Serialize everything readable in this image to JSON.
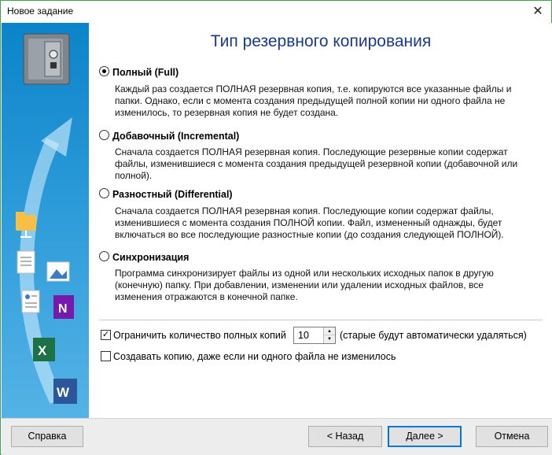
{
  "window": {
    "title": "Новое задание",
    "close": "✕"
  },
  "heading": "Тип резервного копирования",
  "options": [
    {
      "label": "Полный (Full)",
      "checked": true,
      "desc": [
        "Каждый раз создается ПОЛНАЯ резервная копия, т.е. копируются все указанные файлы и",
        "папки. Однако, если с момента создания предыдущей полной копии ни одного файла не",
        "изменилось, то резервная копия не будет создана."
      ]
    },
    {
      "label": "Добавочный (Incremental)",
      "checked": false,
      "desc": [
        "Сначала создается ПОЛНАЯ резервная копия. Последующие резервные копии содержат",
        "файлы, изменившиеся с момента создания предыдущей резервной копии (добавочной или",
        "полной)."
      ]
    },
    {
      "label": "Разностный (Differential)",
      "checked": false,
      "desc": [
        "Сначала создается ПОЛНАЯ резервная копия. Последующие копии содержат файлы,",
        "изменившиеся с момента создания ПОЛНОЙ копии. Файл, измененный однажды, будет",
        "включаться во все последующие разностные копии (до создания следующей ПОЛНОЙ)."
      ]
    },
    {
      "label": "Синхронизация",
      "checked": false,
      "desc": [
        "Программа синхронизирует файлы из одной или нескольких исходных папок в другую",
        "(конечную) папку. При добавлении, изменении или удалении исходных файлов, все",
        "изменения отражаются в конечной папке."
      ]
    }
  ],
  "limit": {
    "label": "Ограничить количество полных копий",
    "checked": true,
    "value": "10",
    "note": "(старые будут автоматически удаляться)"
  },
  "always_copy": {
    "label": "Создавать копию, даже если ни одного файла не изменилось",
    "checked": false
  },
  "buttons": {
    "help": "Справка",
    "back": "< Назад",
    "next": "Далее >",
    "cancel": "Отмена"
  },
  "colors": {
    "accent": "#0078d7",
    "heading": "#1a3a8c",
    "sidebar": "#2b9ad8",
    "border": "#3fa34a"
  },
  "sidebar_icons": [
    "safe-icon",
    "folder-network-icon",
    "document-icon",
    "image-icon",
    "contacts-icon",
    "onenote-icon",
    "excel-icon",
    "word-icon"
  ]
}
